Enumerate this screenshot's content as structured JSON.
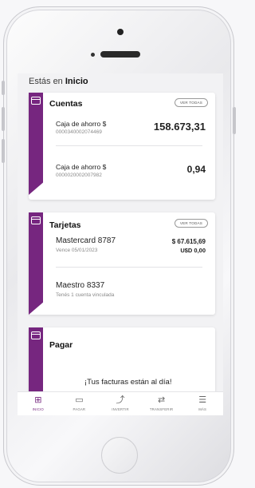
{
  "breadcrumb": {
    "prefix": "Estás en",
    "current": "Inicio"
  },
  "cuentas": {
    "title": "Cuentas",
    "ver_todas": "VER TODAS",
    "accounts": [
      {
        "name": "Caja de ahorro $",
        "number": "0000340002074469",
        "balance": "158.673,31"
      },
      {
        "name": "Caja de ahorro $",
        "number": "0000020002007982",
        "balance": "0,94"
      }
    ]
  },
  "tarjetas": {
    "title": "Tarjetas",
    "ver_todas": "VER TODAS",
    "cards": [
      {
        "name": "Mastercard 8787",
        "detail": "Vence 05/01/2023",
        "balance_ars": "$ 67.615,69",
        "balance_usd": "U$D 0,00"
      },
      {
        "name": "Maestro 8337",
        "detail": "Tenés 1 cuenta vinculada"
      }
    ]
  },
  "pagar": {
    "title": "Pagar",
    "message": "¡Tus facturas están al día!"
  },
  "tabs": [
    {
      "label": "INICIO",
      "icon": "grid-icon",
      "active": true
    },
    {
      "label": "PAGAR",
      "icon": "wallet-icon"
    },
    {
      "label": "INVERTIR",
      "icon": "trend-icon"
    },
    {
      "label": "TRANSFERIR",
      "icon": "transfer-icon"
    },
    {
      "label": "MÁS",
      "icon": "menu-icon"
    }
  ],
  "colors": {
    "accent": "#76267f",
    "background": "#f2f2f4",
    "card": "#ffffff"
  }
}
